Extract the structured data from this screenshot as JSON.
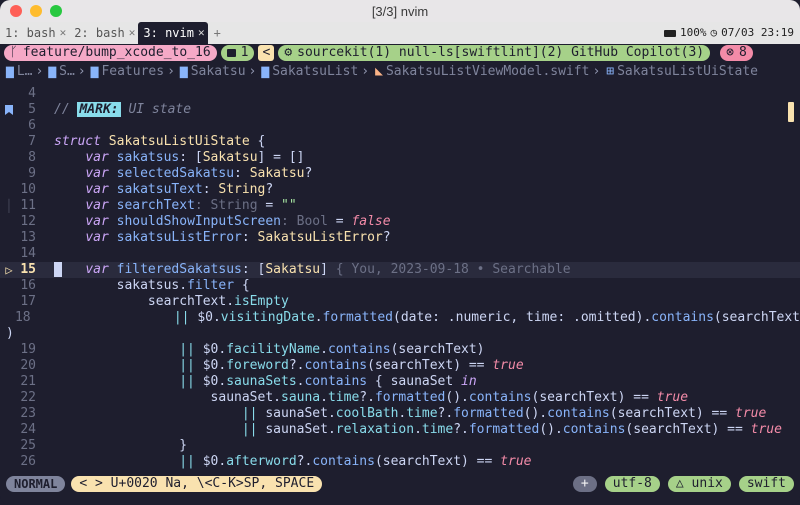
{
  "window": {
    "title": "[3/3] nvim"
  },
  "tmux": {
    "tabs": [
      {
        "label": "1: bash",
        "active": false
      },
      {
        "label": "2: bash",
        "active": false
      },
      {
        "label": "3: nvim",
        "active": true
      }
    ],
    "battery": "100%",
    "datetime": "07/03 23:19"
  },
  "tabline": {
    "branch": "feature/bump_xcode_to_16",
    "tab_number": "1",
    "arrow": "<",
    "lsp": "sourcekit(1) null-ls[swiftlint](2) GitHub Copilot(3)",
    "error_count": "8"
  },
  "breadcrumbs": {
    "items": [
      "L…",
      "S…",
      "Features",
      "Sakatsu",
      "SakatsuList",
      "SakatsuListViewModel.swift",
      "SakatsuListUiState"
    ]
  },
  "code": {
    "l4": "4",
    "l5": "5",
    "mark": "MARK:",
    "mark_text": "UI state",
    "l6": "6",
    "l7": "7",
    "l8": "8",
    "l9": "9",
    "l10": "10",
    "l11": "11",
    "l12": "12",
    "l13": "13",
    "l14": "14",
    "l15": "15",
    "blame": "You, 2023-09-18 • Searchable",
    "l16": "16",
    "l17": "17",
    "l18": "18",
    "l19": "19",
    "l20": "20",
    "l21": "21",
    "l22": "22",
    "l23": "23",
    "l24": "24",
    "l25": "25",
    "l26": "26"
  },
  "statusline": {
    "mode": "NORMAL",
    "char_info": "< > U+0020 Na, \\<C-K>SP, SPACE",
    "plus": "+",
    "encoding": "utf-8",
    "format": "unix",
    "filetype": "swift"
  },
  "colors": {
    "background": "#1e1e2e",
    "keyword": "#cba6f7",
    "type": "#f9e2af",
    "accent": "#89b4fa",
    "string": "#a6e3a1",
    "error": "#f38ba8"
  }
}
